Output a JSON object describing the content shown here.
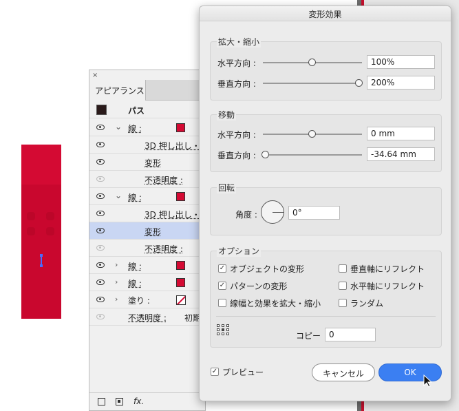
{
  "appearance_panel": {
    "tab": "アピアランス",
    "close": "×",
    "header": "パス",
    "rows": [
      {
        "label": "線 :",
        "indent": 0
      },
      {
        "label": "3D 押し出し・",
        "indent": 1
      },
      {
        "label": "変形",
        "indent": 1
      },
      {
        "label": "不透明度 :",
        "indent": 1
      },
      {
        "label": "線 :",
        "indent": 0
      },
      {
        "label": "3D 押し出し・",
        "indent": 1
      },
      {
        "label": "変形",
        "indent": 1
      },
      {
        "label": "不透明度 :",
        "indent": 1
      },
      {
        "label": "線 :",
        "indent": 0
      },
      {
        "label": "線 :",
        "indent": 0
      },
      {
        "label": "塗り :",
        "indent": 0
      },
      {
        "label": "不透明度 :",
        "value": "初期"
      }
    ],
    "fx": "fx."
  },
  "dialog": {
    "title": "変形効果",
    "scale": {
      "label": "拡大・縮小",
      "horizontal_label": "水平方向 :",
      "horizontal_value": "100%",
      "vertical_label": "垂直方向 :",
      "vertical_value": "200%"
    },
    "move": {
      "label": "移動",
      "horizontal_label": "水平方向 :",
      "horizontal_value": "0 mm",
      "vertical_label": "垂直方向 :",
      "vertical_value": "-34.64 mm"
    },
    "rotate": {
      "label": "回転",
      "angle_label": "角度 :",
      "angle_value": "0°"
    },
    "options": {
      "label": "オプション",
      "transform_objects": "オブジェクトの変形",
      "transform_patterns": "パターンの変形",
      "scale_strokes": "線幅と効果を拡大・縮小",
      "reflect_vertical": "垂直軸にリフレクト",
      "reflect_horizontal": "水平軸にリフレクト",
      "random": "ランダム",
      "copies_label": "コピー",
      "copies_value": "0"
    },
    "preview": "プレビュー",
    "cancel": "キャンセル",
    "ok": "OK",
    "check": "✓"
  },
  "colors": {
    "accent": "#3b7ff2",
    "art_red": "#d40a33"
  }
}
